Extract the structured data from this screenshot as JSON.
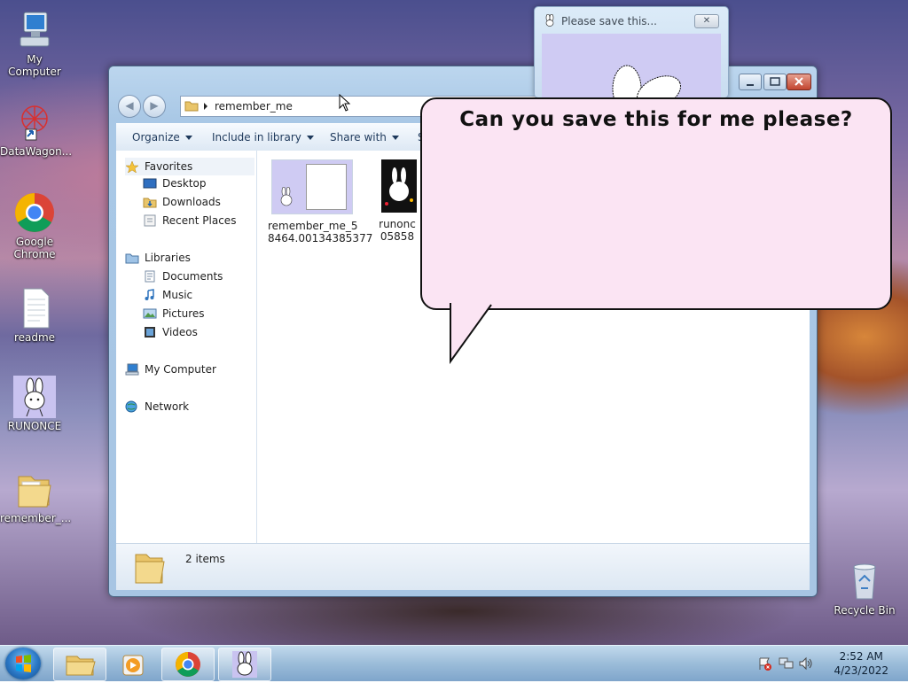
{
  "desktop": {
    "icons": [
      {
        "label": "My Computer",
        "icon": "computer-icon"
      },
      {
        "label": "DataWagon...",
        "icon": "datawagon-icon"
      },
      {
        "label": "Google Chrome",
        "icon": "chrome-icon"
      },
      {
        "label": "readme",
        "icon": "text-file-icon"
      },
      {
        "label": "RUNONCE",
        "icon": "bunny-icon"
      },
      {
        "label": "remember_...",
        "icon": "folder-icon"
      },
      {
        "label": "Recycle Bin",
        "icon": "recycle-bin-icon"
      }
    ]
  },
  "popup": {
    "title": "Please save this...",
    "close_glyph": "✕"
  },
  "bubble": {
    "text": "Can you save this for me please?"
  },
  "explorer": {
    "address": "remember_me",
    "toolbar": [
      "Organize",
      "Include in library",
      "Share with",
      "S"
    ],
    "nav": {
      "favorites_header": "Favorites",
      "favorites": [
        "Desktop",
        "Downloads",
        "Recent Places"
      ],
      "libraries_header": "Libraries",
      "libraries": [
        "Documents",
        "Music",
        "Pictures",
        "Videos"
      ],
      "computer": "My Computer",
      "network": "Network"
    },
    "files": [
      {
        "name_line1": "remember_me_5",
        "name_line2": "8464.00134385377"
      },
      {
        "name_line1": "runonc",
        "name_line2": "05858"
      }
    ],
    "status": "2 items"
  },
  "taskbar": {
    "time": "2:52 AM",
    "date": "4/23/2022",
    "buttons": [
      "explorer-icon",
      "media-player-icon",
      "chrome-icon",
      "bunny-icon"
    ]
  }
}
